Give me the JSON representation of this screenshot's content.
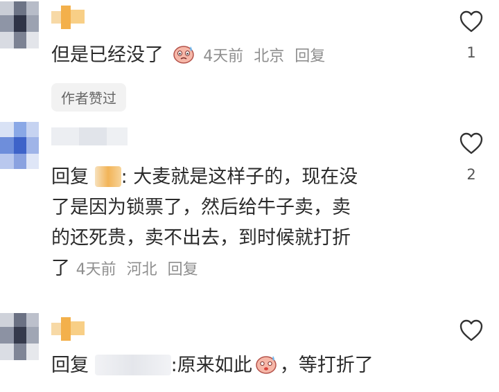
{
  "comments": [
    {
      "text": "但是已经没了",
      "meta": {
        "time": "4天前",
        "location": "北京",
        "reply": "回复"
      },
      "like_count": "1",
      "author_tag": "作者赞过"
    },
    {
      "reply_prefix": "回复",
      "lines": [
        ": 大麦就是这样子的，现在没",
        "了是因为锁票了，然后给牛子卖，卖",
        "的还死贵，卖不出去，到时候就打折"
      ],
      "last_line": "了",
      "meta": {
        "time": "4天前",
        "location": "河北",
        "reply": "回复"
      },
      "like_count": "2"
    },
    {
      "reply_prefix": "回复",
      "text_a": ":原来如此",
      "text_b": "，等打折了"
    }
  ],
  "icons": {
    "like": "heart-outline-icon",
    "emoji": "crying-face-emoji-icon"
  },
  "colors": {
    "text": "#2b2b2b",
    "meta": "#8e8e8e",
    "tag_bg": "#f2f2f2"
  }
}
